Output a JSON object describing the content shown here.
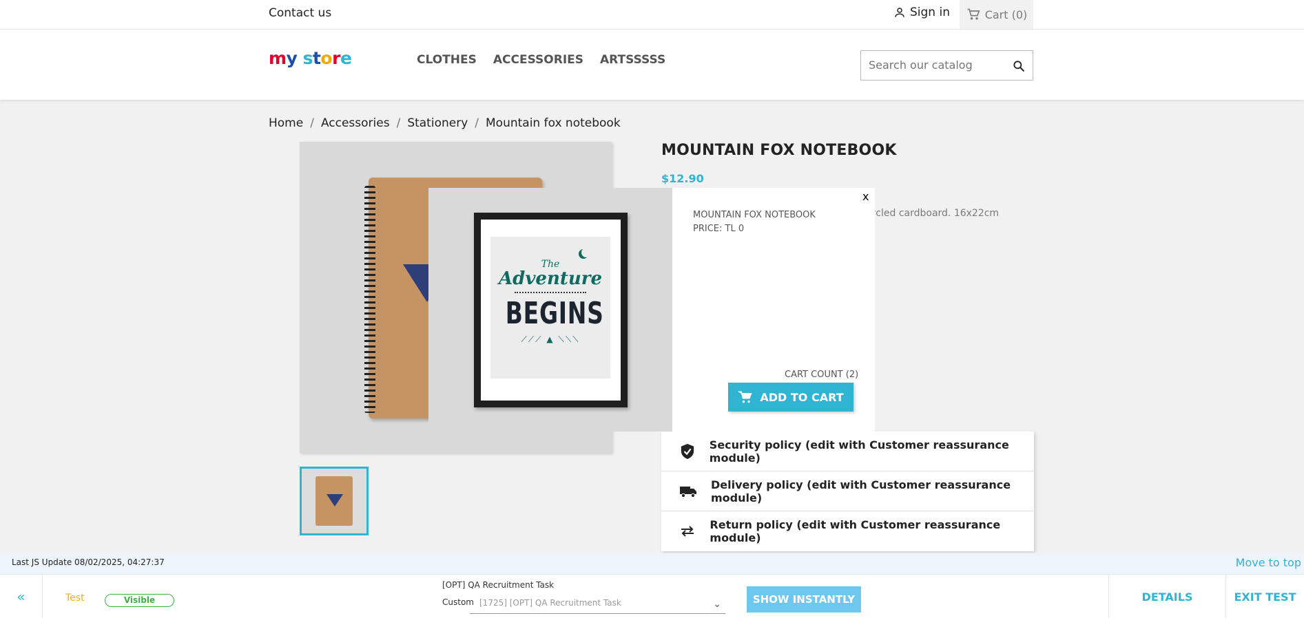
{
  "topbar": {
    "contact": "Contact us",
    "signin": "Sign in",
    "cart": "Cart (0)"
  },
  "header": {
    "logo": "my store",
    "nav": [
      "CLOTHES",
      "ACCESSORIES",
      "ARTSSSSS"
    ],
    "search_placeholder": "Search our catalog"
  },
  "breadcrumb": [
    "Home",
    "Accessories",
    "Stationery",
    "Mountain fox notebook"
  ],
  "product": {
    "title": "MOUNTAIN FOX NOTEBOOK",
    "price": "$12.90",
    "desc_fragment": "ycled cardboard. 16x22cm"
  },
  "popup": {
    "close": "x",
    "name": "MOUNTAIN FOX NOTEBOOK",
    "price": "PRICE: TL 0",
    "cart_count": "CART COUNT (2)",
    "add_to_cart": "ADD TO CART",
    "art_the": "The",
    "art_adventure": "Adventure",
    "art_begins": "BEGINS"
  },
  "reassurance": [
    {
      "icon": "shield-icon",
      "label": "Security policy (edit with Customer reassurance module)"
    },
    {
      "icon": "truck-icon",
      "label": "Delivery policy (edit with Customer reassurance module)"
    },
    {
      "icon": "swap-icon",
      "label": "Return policy (edit with Customer reassurance module)"
    }
  ],
  "debug": {
    "last_update": "Last JS Update 08/02/2025, 04:27:37",
    "move_to_top": "Move to top",
    "collapse": "«",
    "test": "Test",
    "visible": "Visible",
    "campaign": "[OPT] QA Recruitment Task",
    "custom_label": "Custom",
    "custom_value": "[1725] [OPT] QA Recruitment Task",
    "show_instantly": "SHOW INSTANTLY",
    "details": "DETAILS",
    "exit_test": "EXIT TEST"
  },
  "colors": {
    "accent": "#2fb5d2",
    "visible_badge": "#3fb043",
    "test_label": "#f0b400"
  }
}
